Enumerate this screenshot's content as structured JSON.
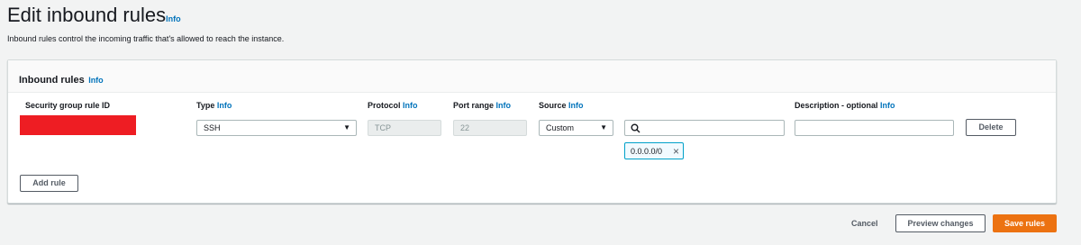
{
  "header": {
    "title": "Edit inbound rules",
    "info": "Info",
    "subtitle": "Inbound rules control the incoming traffic that's allowed to reach the instance."
  },
  "panel": {
    "title": "Inbound rules",
    "info": "Info",
    "columns": {
      "rule_id": "Security group rule ID",
      "type": "Type",
      "protocol": "Protocol",
      "port_range": "Port range",
      "source": "Source",
      "description": "Description - optional",
      "info": "Info"
    },
    "row": {
      "type_value": "SSH",
      "protocol_value": "TCP",
      "port_value": "22",
      "source_value": "Custom",
      "cidr_token": "0.0.0.0/0",
      "search_value": "",
      "description_value": "",
      "delete_label": "Delete"
    },
    "add_rule_label": "Add rule"
  },
  "footer": {
    "cancel_label": "Cancel",
    "preview_label": "Preview changes",
    "save_label": "Save rules"
  },
  "colors": {
    "accent": "#0073bb",
    "primary": "#ec7211",
    "redaction": "#ee1d23"
  }
}
